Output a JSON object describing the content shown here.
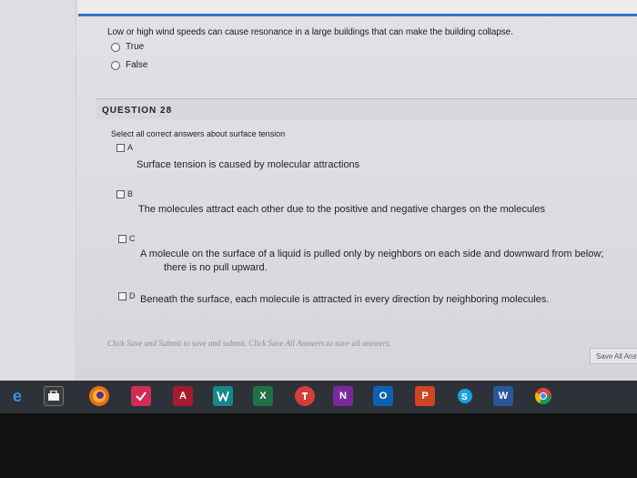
{
  "question27": {
    "prompt": "Low or high wind speeds can cause resonance in a large buildings that can make the building collapse.",
    "options": [
      {
        "label": "True"
      },
      {
        "label": "False"
      }
    ]
  },
  "question28": {
    "header": "QUESTION 28",
    "instruction": "Select all correct answers about surface tension",
    "answers": [
      {
        "letter": "A",
        "text": "Surface tension is caused by molecular attractions"
      },
      {
        "letter": "B",
        "text": "The molecules attract each other due to the positive and negative charges on the molecules"
      },
      {
        "letter": "C",
        "text": "A molecule on the surface of a liquid is pulled only by neighbors on each side and downward from below;",
        "text2": "there is no pull upward."
      },
      {
        "letter": "D",
        "text": "Beneath the surface, each molecule is attracted in every direction by neighboring molecules."
      }
    ]
  },
  "footer": {
    "instructions": "Click Save and Submit to save and submit. Click Save All Answers to save all answers.",
    "save_all_label": "Save All Answers"
  },
  "taskbar": {
    "icons": [
      "edge-icon",
      "store-icon",
      "firefox-icon",
      "security-icon",
      "access-icon",
      "sway-icon",
      "excel-icon",
      "todoist-icon",
      "onenote-icon",
      "outlook-icon",
      "powerpoint-icon",
      "skype-icon",
      "word-icon",
      "chrome-icon"
    ],
    "icon_labels": {
      "access": "A",
      "excel": "X",
      "onenote": "N",
      "outlook": "O",
      "powerpoint": "P",
      "word": "W"
    }
  }
}
